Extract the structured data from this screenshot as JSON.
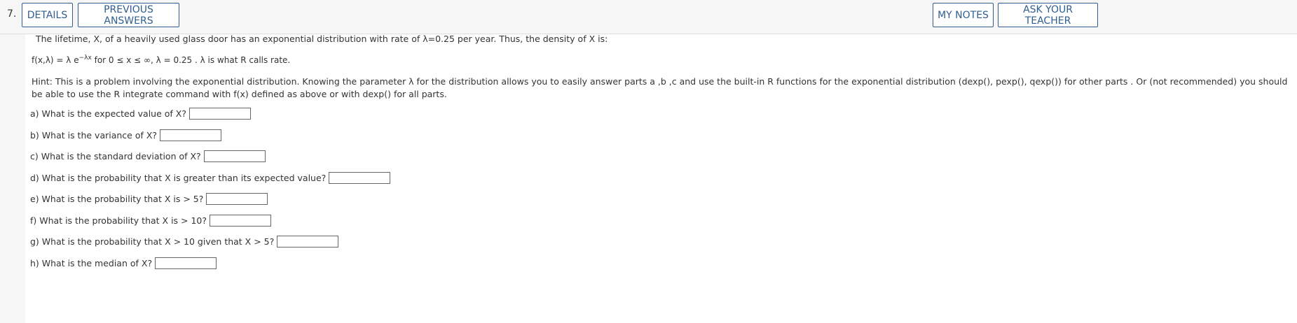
{
  "question": {
    "number": "7.",
    "buttons": {
      "details": "DETAILS",
      "previous_answers": "PREVIOUS ANSWERS",
      "my_notes": "MY NOTES",
      "ask_teacher": "ASK YOUR TEACHER"
    }
  },
  "problem": {
    "intro": "The lifetime, X, of a heavily used glass door has an exponential distribution with rate of λ=0.25 per year. Thus, the density of X is:",
    "formula_lhs": "f(x,λ) = λ e",
    "formula_exp": "−λx",
    "formula_rhs": " for 0 ≤ x ≤ ∞, λ = 0.25 . λ is what R calls rate.",
    "hint": "Hint: This is a problem involving the exponential distribution. Knowing the parameter λ for the distribution allows you to easily answer parts a ,b ,c and use the built-in R functions for the exponential distribution (dexp(), pexp(), qexp()) for other parts . Or (not recommended) you should be able to use the R integrate command with f(x) defined as above or with dexp() for all parts."
  },
  "parts": [
    {
      "label": "a) What is the expected value of X?",
      "value": ""
    },
    {
      "label": "b) What is the variance of X?",
      "value": ""
    },
    {
      "label": "c) What is the standard deviation of X?",
      "value": ""
    },
    {
      "label": "d) What is the probability that X is greater than its expected value?",
      "value": ""
    },
    {
      "label": "e) What is the probability that X is > 5?",
      "value": ""
    },
    {
      "label": "f) What is the probability that X is > 10?",
      "value": ""
    },
    {
      "label": "g) What is the probability that X > 10 given that X > 5?",
      "value": ""
    },
    {
      "label": "h) What is the median of X?",
      "value": ""
    }
  ]
}
